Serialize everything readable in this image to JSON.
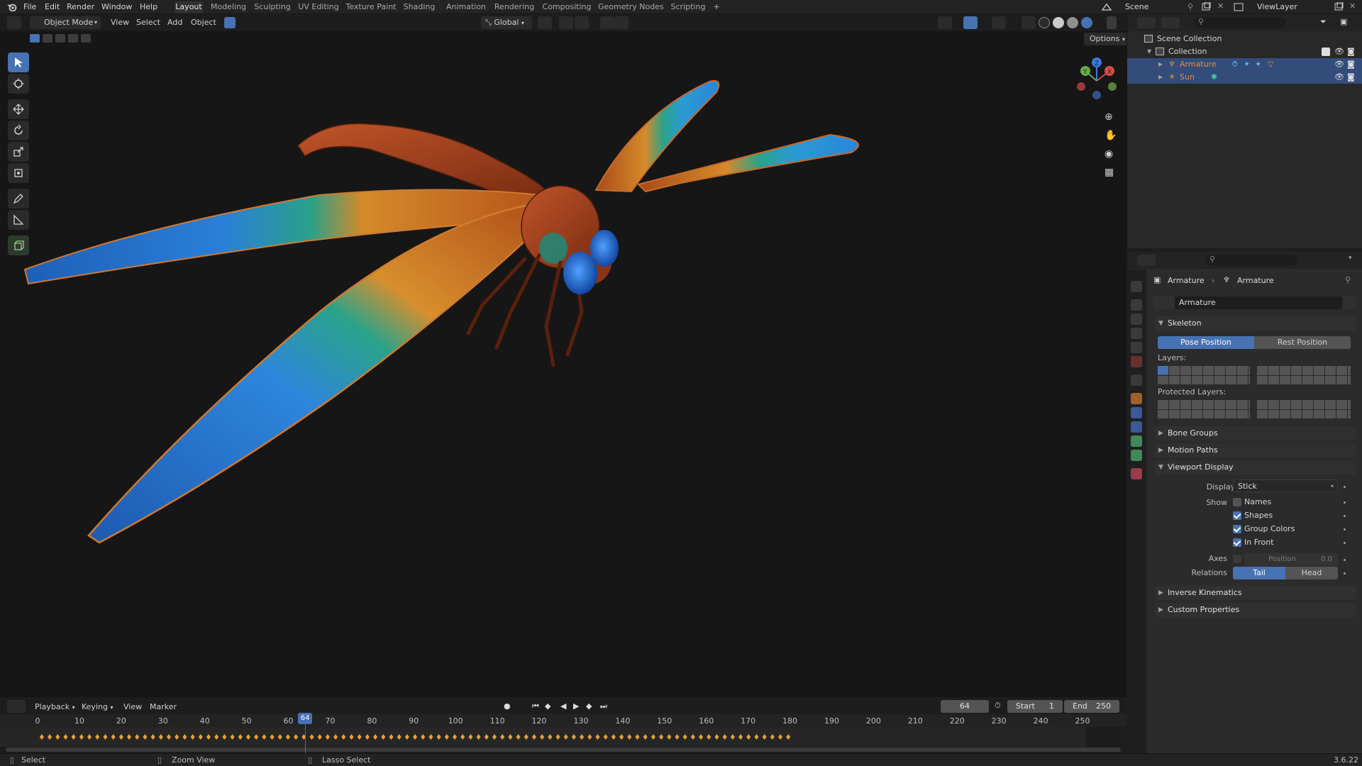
{
  "app": {
    "version": "3.6.22"
  },
  "menu": [
    "File",
    "Edit",
    "Render",
    "Window",
    "Help"
  ],
  "workspaces": [
    "Layout",
    "Modeling",
    "Sculpting",
    "UV Editing",
    "Texture Paint",
    "Shading",
    "Animation",
    "Rendering",
    "Compositing",
    "Geometry Nodes",
    "Scripting"
  ],
  "active_workspace": "Layout",
  "scene_name": "Scene",
  "view_layer": "ViewLayer",
  "viewport_header": {
    "mode": "Object Mode",
    "menus": [
      "View",
      "Select",
      "Add",
      "Object"
    ],
    "transform_orientation": "Global",
    "options": "Options"
  },
  "outliner": {
    "rows": [
      {
        "label": "Scene Collection"
      },
      {
        "label": "Collection"
      },
      {
        "label": "Armature"
      },
      {
        "label": "Sun"
      }
    ]
  },
  "properties": {
    "breadcrumb": [
      "Armature",
      "Armature"
    ],
    "data_name": "Armature",
    "skeleton": {
      "title": "Skeleton",
      "pose_position": "Pose Position",
      "rest_position": "Rest Position",
      "layers": "Layers:",
      "protected_layers": "Protected Layers:"
    },
    "bone_groups": "Bone Groups",
    "motion_paths": "Motion Paths",
    "viewport_display": {
      "title": "Viewport Display",
      "display_as_label": "Display As",
      "display_as_value": "Stick",
      "show_label": "Show",
      "names": {
        "label": "Names",
        "checked": false
      },
      "shapes": {
        "label": "Shapes",
        "checked": true
      },
      "group_colors": {
        "label": "Group Colors",
        "checked": true
      },
      "in_front": {
        "label": "In Front",
        "checked": true
      },
      "axes_label": "Axes",
      "axes_position_label": "Position",
      "axes_position_value": "0.0",
      "relations_label": "Relations",
      "relations_tail": "Tail",
      "relations_head": "Head"
    },
    "inverse_kinematics": "Inverse Kinematics",
    "custom_properties": "Custom Properties"
  },
  "timeline": {
    "menus": [
      "Playback",
      "Keying",
      "View",
      "Marker"
    ],
    "current_frame": "64",
    "start_label": "Start",
    "start_value": "1",
    "end_label": "End",
    "end_value": "250",
    "frame_numbers": [
      "0",
      "10",
      "20",
      "30",
      "40",
      "50",
      "60",
      "70",
      "80",
      "90",
      "100",
      "110",
      "120",
      "130",
      "140",
      "150",
      "160",
      "170",
      "180",
      "190",
      "200",
      "210",
      "220",
      "230",
      "240",
      "250"
    ],
    "playhead_label": "64"
  },
  "statusbar": {
    "select": "Select",
    "zoom_view": "Zoom View",
    "lasso_select": "Lasso Select"
  },
  "colors": {
    "accent": "#4772b3",
    "selection": "#334c7a",
    "armature_orange": "#e88b3a",
    "keyframe": "#e8a03a"
  }
}
